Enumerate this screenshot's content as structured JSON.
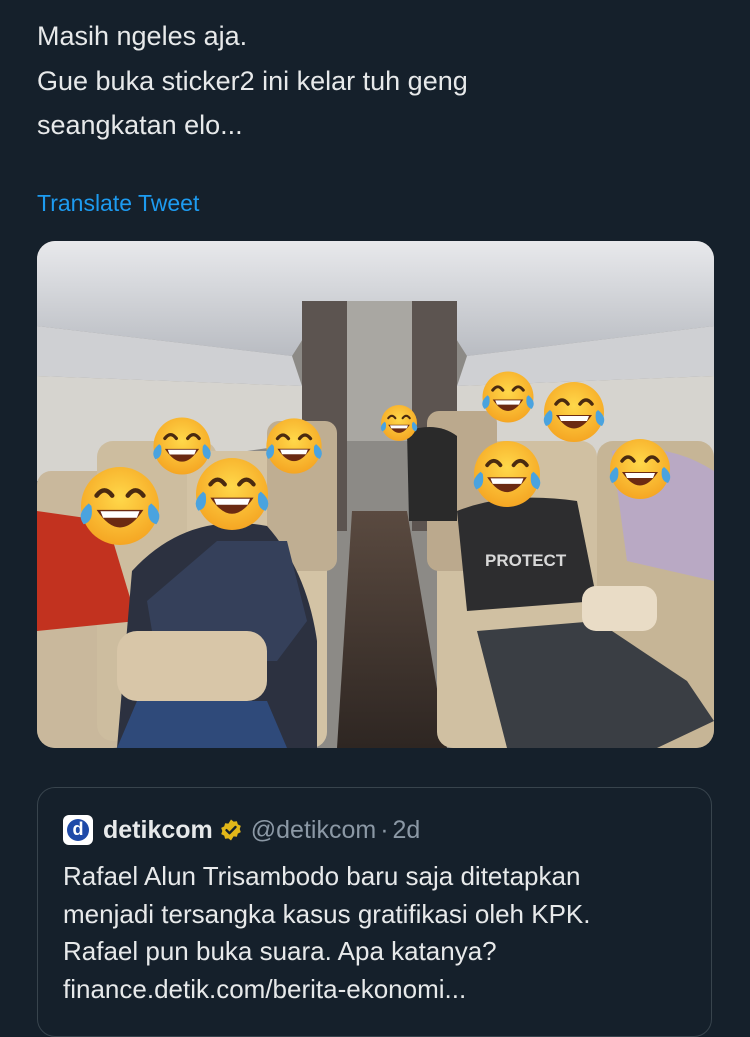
{
  "tweet": {
    "text_lines": [
      "Masih ngeles aja.",
      "Gue buka sticker2 ini kelar tuh geng",
      "seangkatan elo..."
    ],
    "translate_label": "Translate Tweet",
    "photo_overlay_text": "PROTECT"
  },
  "quote": {
    "avatar_letter": "d",
    "name": "detikcom",
    "handle": "@detikcom",
    "separator": "·",
    "time": "2d",
    "body_lines": [
      "Rafael Alun Trisambodo baru saja ditetapkan",
      "menjadi tersangka kasus gratifikasi oleh KPK.",
      "Rafael pun buka suara. Apa katanya?",
      "finance.detik.com/berita-ekonomi..."
    ]
  },
  "icons": {
    "verified": "verified-badge-icon",
    "emoji": "face-with-tears-of-joy"
  },
  "colors": {
    "background": "#15202b",
    "text": "#e7e9ea",
    "secondary": "#8b98a5",
    "link": "#1d9bf0",
    "verified_gold": "#e2b719",
    "border": "#38444d"
  }
}
